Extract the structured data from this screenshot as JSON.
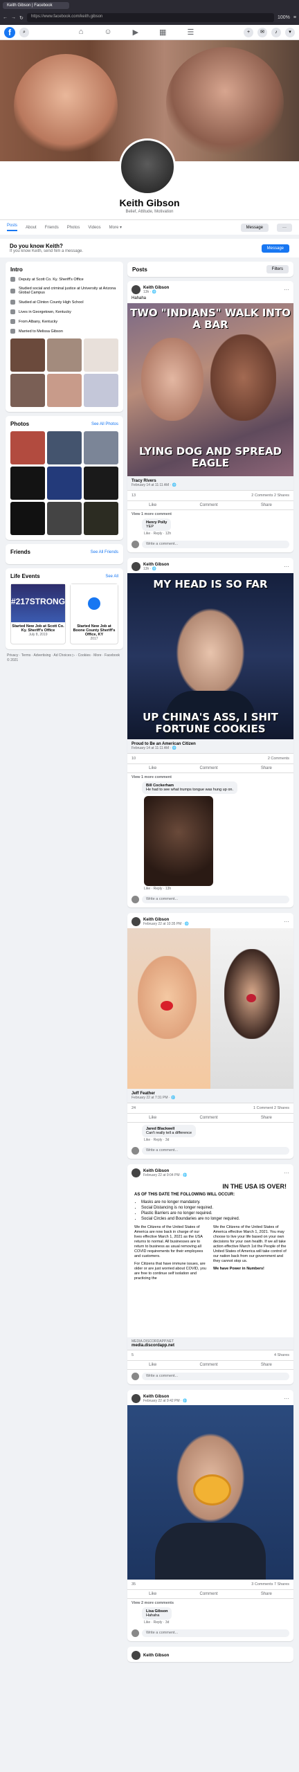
{
  "browser": {
    "tab_title": "Keith Gibson | Facebook",
    "url": "https://www.facebook.com/keith.gibson",
    "zoom": "100%"
  },
  "nav": {
    "logo": "f"
  },
  "profile": {
    "name": "Keith Gibson",
    "bio": "Belief, Attitude, Motivation",
    "tabs": [
      "Posts",
      "About",
      "Friends",
      "Photos",
      "Videos",
      "More ▾"
    ],
    "message_label": "Message",
    "more_label": "···"
  },
  "dyk": {
    "title": "Do you know Keith?",
    "subtitle": "If you know Keith, send him a message.",
    "button": "Message"
  },
  "intro": {
    "title": "Intro",
    "items": [
      "Deputy at Scott Co. Ky. Sheriff's Office",
      "Studied social and criminal justice at University at Arizona Global Campus",
      "Studied at Clinton County High School",
      "Lives in Georgetown, Kentucky",
      "From Albany, Kentucky",
      "Married to Melissa Gibson"
    ]
  },
  "intro_photos_colors": [
    "#6b4a3c",
    "#a38b7d",
    "#e8e0da",
    "#7a5f55",
    "#c89b8a",
    "#c4c7d9"
  ],
  "photos": {
    "title": "Photos",
    "link": "See All Photos",
    "colors": [
      "#b24b3f",
      "#44546e",
      "#7b8597",
      "#131313",
      "#233a7a",
      "#1a1a1a",
      "#111",
      "#444",
      "#2c2c22"
    ]
  },
  "friends": {
    "title": "Friends",
    "link": "See All Friends"
  },
  "life": {
    "title": "Life Events",
    "link": "See All",
    "events": [
      {
        "img": "#217STRONG",
        "title": "Started New Job at Scott Co. Ky. Sheriff's Office",
        "date": "July 8, 2019"
      },
      {
        "title": "Started New Job at Boone County Sheriff's Office, KY",
        "date": "2017"
      }
    ]
  },
  "footer": "Privacy · Terms · Advertising · Ad Choices ▷ · Cookies · More · Facebook © 2021",
  "posts_header": {
    "title": "Posts",
    "filters": "Filters"
  },
  "posts": [
    {
      "author": "Keith Gibson",
      "time": "13h · 🌐",
      "text": "Hahaha",
      "meme_top": "TWO \"INDIANS\" WALK INTO A BAR",
      "meme_bottom": "LYING DOG AND SPREAD EAGLE",
      "share_author": "Tracy Rivers",
      "share_date": "February 14 at 11:11 AM · 🌐",
      "reactions": "13",
      "stats_right": "2 Comments 2 Shares",
      "view_more": "View 1 more comment",
      "comments": [
        {
          "name": "Henry Polly",
          "text": "YEP",
          "meta": "Like · Reply · 12h"
        }
      ],
      "write": "Write a comment..."
    },
    {
      "author": "Keith Gibson",
      "time": "13h · 🌐",
      "text": "",
      "meme_top": "MY HEAD IS SO FAR",
      "meme_bottom": "UP CHINA'S ASS, I SHIT FORTUNE COOKIES",
      "share_author": "Proud to Be an American Citizen",
      "share_date": "February 14 at 11:11 AM · 🌐",
      "reactions": "10",
      "stats_right": "2 Comments",
      "view_more": "View 1 more comment",
      "comments": [
        {
          "name": "Bill Cockerham",
          "text": "He had to see what trumps tongue was hung up on.",
          "meta": "Like · Reply · 13h"
        }
      ],
      "write": "Write a comment..."
    },
    {
      "author": "Keith Gibson",
      "time": "February 22 at 10:35 PM · 🌐",
      "text": "",
      "meme_top": "",
      "meme_bottom": "",
      "share_author": "Jeff Feather",
      "share_date": "February 22 at 7:31 PM · 🌐",
      "reactions": "24",
      "stats_right": "1 Comment 2 Shares",
      "view_more": "",
      "comments": [
        {
          "name": "Jared Blackwell",
          "text": "Can't really tell a difference",
          "meta": "Like · Reply · 3d"
        }
      ],
      "write": "Write a comment..."
    },
    {
      "author": "Keith Gibson",
      "time": "February 22 at 9:04 PM · 🌐",
      "text": "",
      "meme_top": "IN THE USA IS OVER!",
      "meme_bottom": "",
      "doc_heading": "AS OF THIS DATE THE FOLLOWING WILL OCCUR:",
      "doc_items": [
        "Masks are no longer mandatory.",
        "Social Distancing is no longer required.",
        "Plastic Barriers are no longer required.",
        "Social Circles and Boundaries are no longer required."
      ],
      "doc_col1": "We the Citizens of the United States of America are now back in charge of our lives effective March 1, 2021 as the USA returns to normal. All businesses are to return to business as usual removing all COVID requirements for their employees and customers.",
      "doc_col2": "We the Citizens of the United States of America effective March 1, 2021. You may choose to live your life based on your own decisions for your own health. If we all take action effective March 1st the People of the United States of America will take control of our nation back from our government and they cannot stop us.",
      "doc_col1b": "For Citizens that have immune issues, are older or are just worried about COVID, you are free to continue self isolation and practicing the",
      "doc_col2b": "We have Power in Numbers!",
      "link_domain": "MEDIA.DISCORDAPP.NET",
      "link_title": "media.discordapp.net",
      "reactions": "5",
      "stats_right": "4 Shares",
      "view_more": "",
      "comments": [],
      "write": "Write a comment..."
    },
    {
      "author": "Keith Gibson",
      "time": "February 22 at 9:42 PM · 🌐",
      "text": "",
      "meme_top": "",
      "meme_bottom": "",
      "reactions": "35",
      "stats_right": "3 Comments 7 Shares",
      "view_more": "View 2 more comments",
      "comments": [
        {
          "name": "Lisa Gibson",
          "text": "Hahaha",
          "meta": "Like · Reply · 3d"
        }
      ],
      "write": "Write a comment..."
    },
    {
      "author": "Keith Gibson",
      "time": "",
      "text": ""
    }
  ],
  "actions": {
    "like": "Like",
    "comment": "Comment",
    "share": "Share"
  }
}
